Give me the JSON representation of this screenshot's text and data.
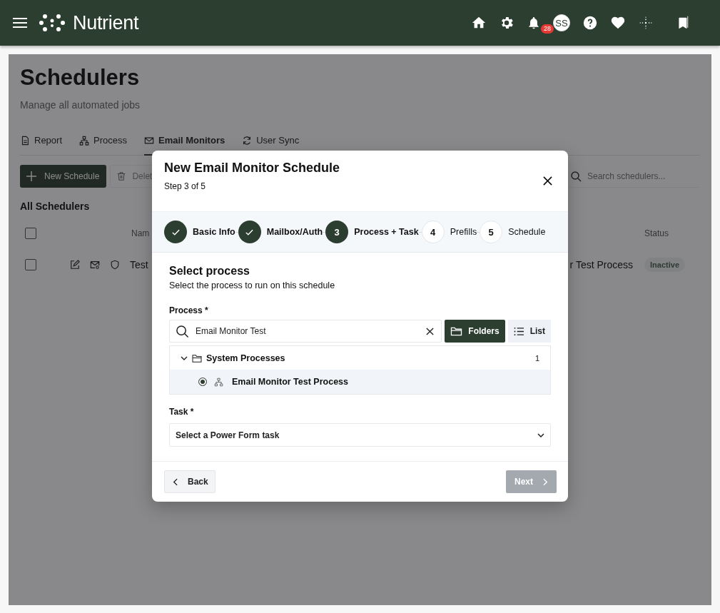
{
  "app": {
    "brand": "Nutrient",
    "notification_count": "28",
    "avatar_initials": "SS"
  },
  "page": {
    "title": "Schedulers",
    "subtitle": "Manage all automated jobs",
    "tabs": [
      {
        "label": "Report",
        "selected": false
      },
      {
        "label": "Process",
        "selected": false
      },
      {
        "label": "Email Monitors",
        "selected": true
      },
      {
        "label": "User Sync",
        "selected": false
      }
    ],
    "new_button": "New Schedule",
    "delete_button": "Delet",
    "search": {
      "placeholder": "Search schedulers..."
    },
    "section_title": "All Schedulers",
    "table": {
      "select_all_checked": false,
      "columns": [
        "Nam",
        "Status"
      ],
      "rows": [
        {
          "checked": false,
          "name": "Test",
          "process": "r Test Process",
          "status": "Inactive"
        }
      ]
    }
  },
  "modal": {
    "title": "New Email Monitor Schedule",
    "step": "Step 3 of 5",
    "steps": [
      {
        "label": "Basic Info",
        "done": true,
        "current": false
      },
      {
        "label": "Mailbox/Auth",
        "done": true,
        "current": false
      },
      {
        "number": "3",
        "label": "Process + Task",
        "done": false,
        "current": true
      },
      {
        "number": "4",
        "label": "Prefills",
        "done": false,
        "current": false
      },
      {
        "number": "5",
        "label": "Schedule",
        "done": false,
        "current": false
      }
    ],
    "section": {
      "title": "Select process",
      "description": "Select the process to run on this schedule"
    },
    "process_field": {
      "label": "Process *",
      "value": "Email Monitor Test"
    },
    "view_toggle": [
      {
        "label": "Folders",
        "selected": true
      },
      {
        "label": "List",
        "selected": false
      }
    ],
    "tree": [
      {
        "label": "System Processes",
        "count": "1",
        "expanded": true,
        "children": [
          {
            "label": "Email Monitor Test Process",
            "selected": true
          }
        ]
      }
    ],
    "task_field": {
      "label": "Task *",
      "value": "Select a Power Form task"
    },
    "back_button": "Back",
    "next_button": {
      "label": "Next",
      "disabled": true
    }
  }
}
